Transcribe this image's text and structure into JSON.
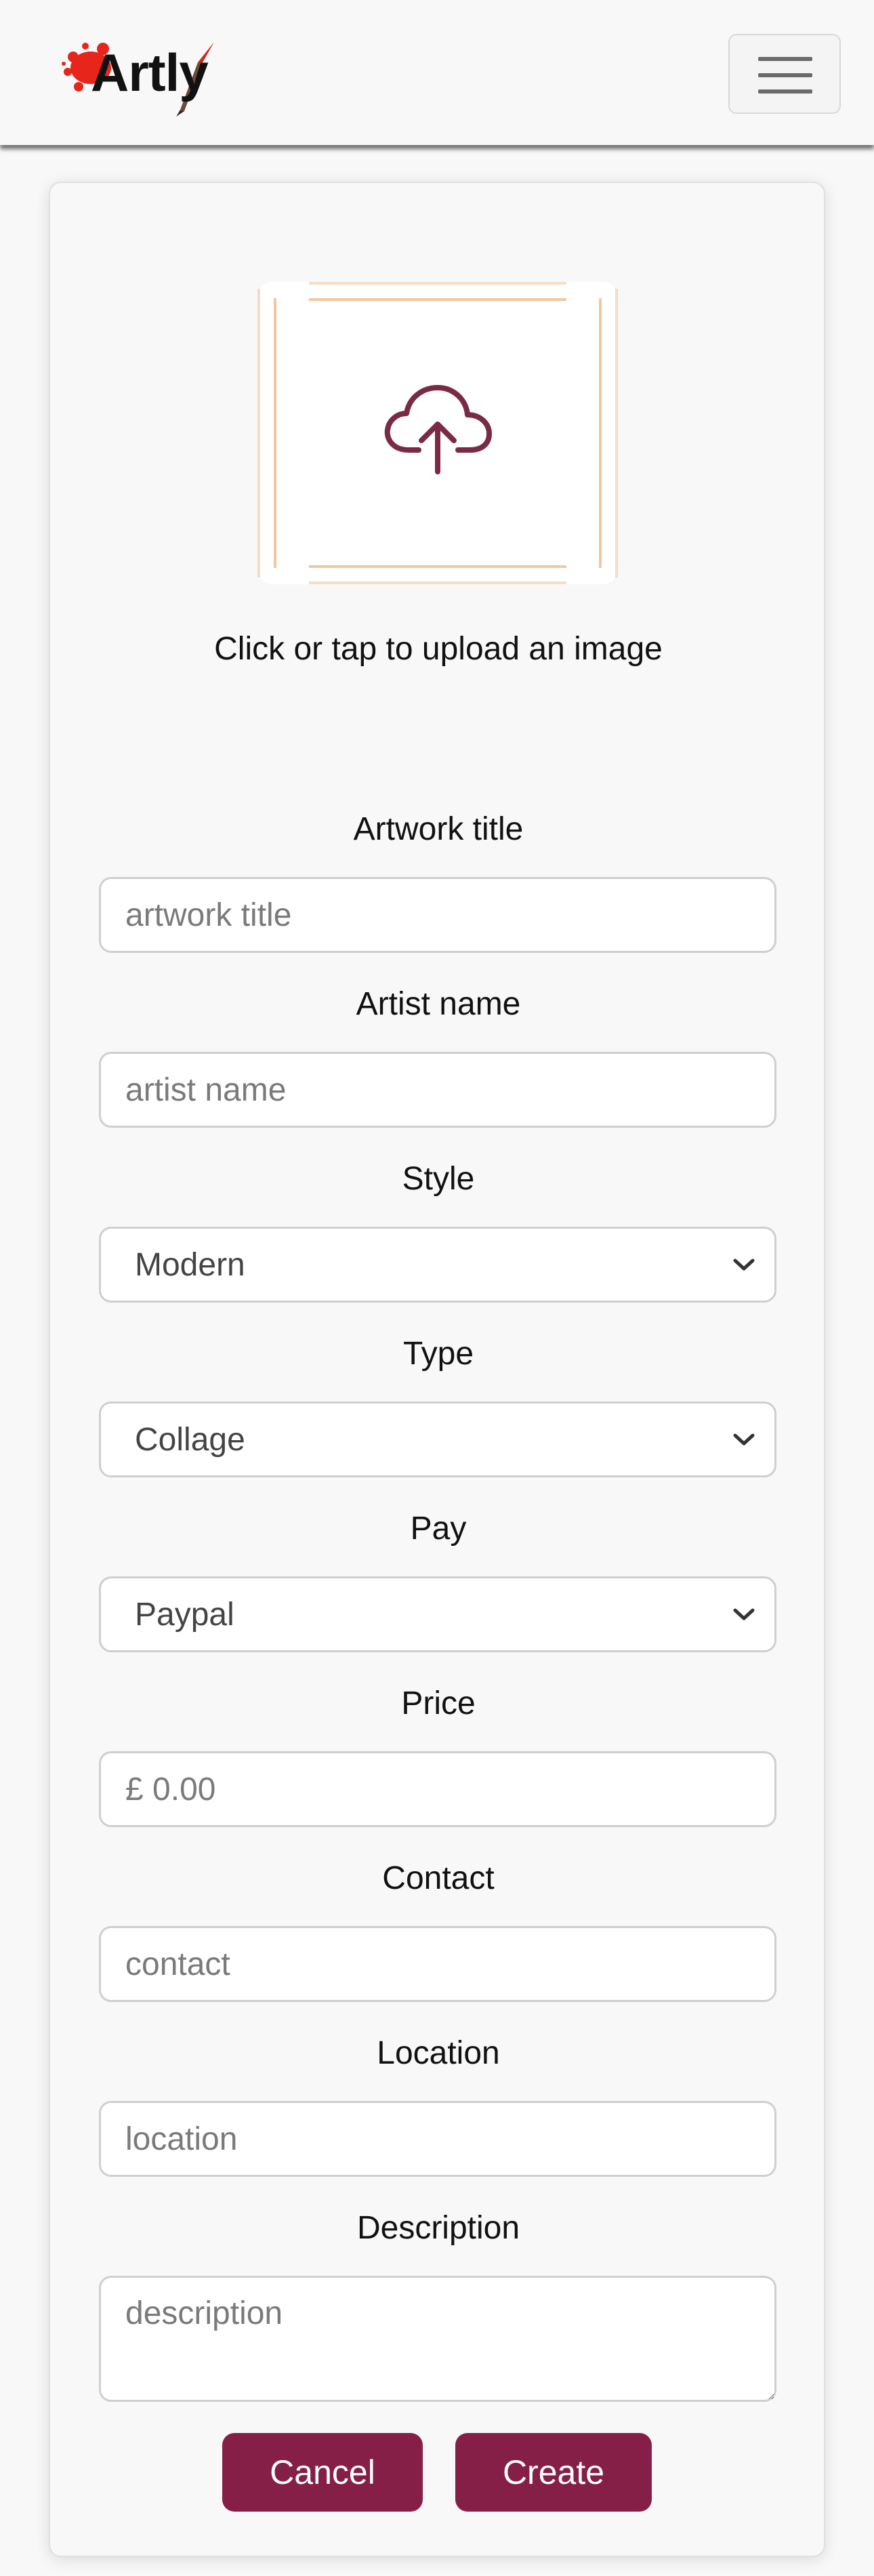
{
  "navbar": {
    "logo_text": "Artly",
    "menu_icon": "hamburger-icon"
  },
  "upload": {
    "icon": "cloud-upload-icon",
    "text": "Click or tap to upload an image"
  },
  "form": {
    "artwork_title": {
      "label": "Artwork title",
      "placeholder": "artwork title"
    },
    "artist_name": {
      "label": "Artist name",
      "placeholder": "artist name"
    },
    "style": {
      "label": "Style",
      "selected": "Modern"
    },
    "type": {
      "label": "Type",
      "selected": "Collage"
    },
    "pay": {
      "label": "Pay",
      "selected": "Paypal"
    },
    "price": {
      "label": "Price",
      "placeholder": "£ 0.00"
    },
    "contact": {
      "label": "Contact",
      "placeholder": "contact"
    },
    "location": {
      "label": "Location",
      "placeholder": "location"
    },
    "description": {
      "label": "Description",
      "placeholder": "description"
    }
  },
  "buttons": {
    "cancel_label": "Cancel",
    "create_label": "Create"
  },
  "colors": {
    "accent": "#851f48",
    "upload_frame": "#f0c79e",
    "cloud_icon": "#7a2a44",
    "logo_splash": "#e8251b"
  }
}
